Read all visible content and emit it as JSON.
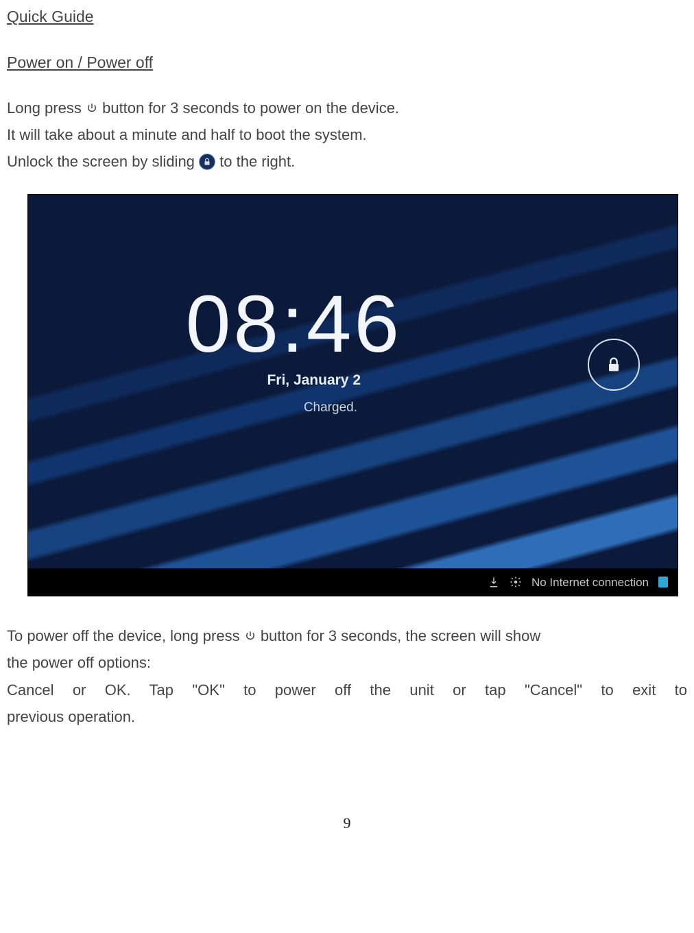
{
  "title": "Quick Guide",
  "section": "Power on / Power off",
  "p1a": "Long press ",
  "p1b": " button for 3 seconds to power on the device.",
  "p2": "It will take about a minute and half to boot the system.",
  "p3a": "Unlock the screen by sliding ",
  "p3b": " to the right.",
  "screenshot": {
    "time": "08:46",
    "date": "Fri, January 2",
    "status": "Charged.",
    "statusbar_text": "No Internet connection"
  },
  "p4a": "To power off the device, long press ",
  "p4b": " button for 3 seconds, the screen will show",
  "p5": "the power off options:",
  "p6": "Cancel  or  OK.   Tap \"OK\" to power off the unit or tap \"Cancel\" to exit to",
  "p7": "previous operation.",
  "page_number": "9"
}
